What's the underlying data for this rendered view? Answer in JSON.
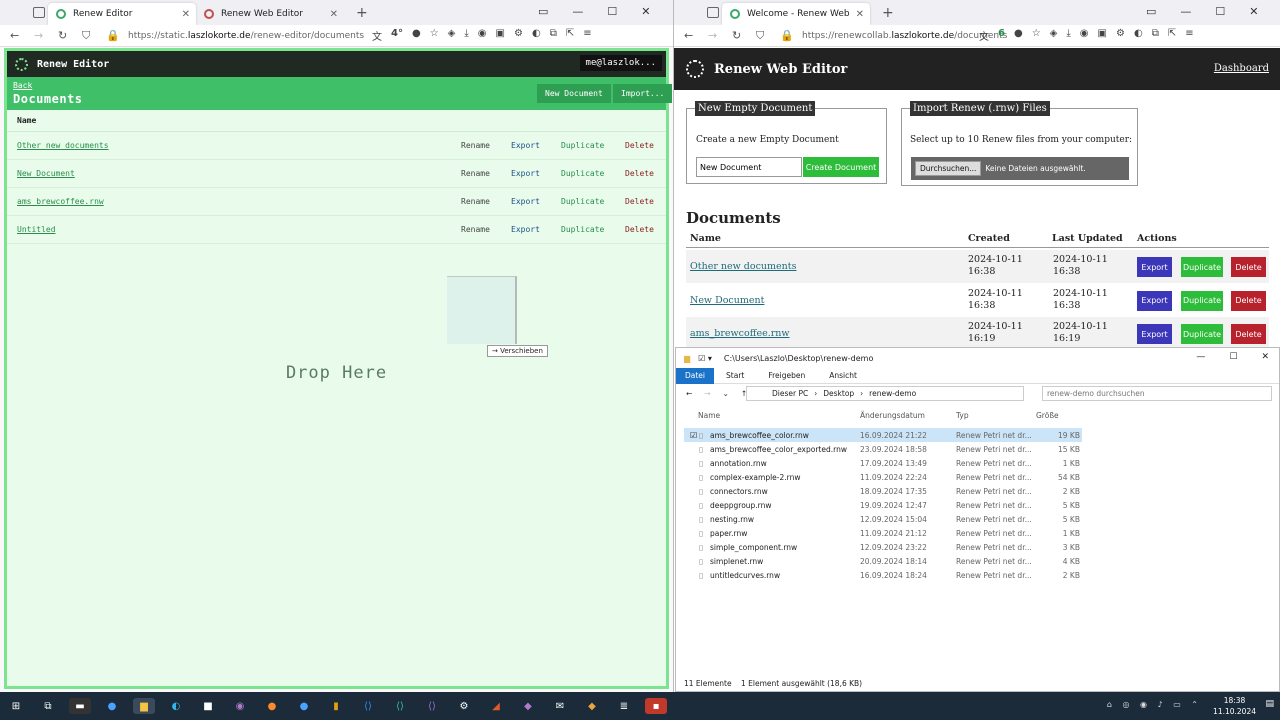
{
  "left_browser": {
    "tabs": [
      {
        "label": "Renew Editor",
        "active": true
      },
      {
        "label": "Renew Web Editor",
        "active": false
      }
    ],
    "url_prefix": "https://static.",
    "url_host": "laszlokorte.de",
    "url_path": "/renew-editor/documents",
    "badge": "4°"
  },
  "editor": {
    "app_title": "Renew Editor",
    "user": "me@laszlok...",
    "back": "Back",
    "title": "Documents",
    "new_document": "New Document",
    "import": "Import...",
    "col_name": "Name",
    "actions": {
      "rename": "Rename",
      "export": "Export",
      "duplicate": "Duplicate",
      "delete": "Delete"
    },
    "documents": [
      "Other new documents",
      "New Document",
      "ams_brewcoffee.rnw",
      "Untitled"
    ],
    "drop_here": "Drop Here",
    "drag_tooltip": "Verschieben"
  },
  "right_browser": {
    "tabs": [
      {
        "label": "Welcome - Renew Web",
        "active": true
      }
    ],
    "url_prefix": "https://renewcollab.",
    "url_host": "laszlokorte.de",
    "url_path": "/documents",
    "badge": "6"
  },
  "webeditor": {
    "app_title": "Renew Web Editor",
    "dashboard": "Dashboard",
    "new_empty": {
      "legend": "New Empty Document",
      "text": "Create a new Empty Document",
      "input_value": "New Document",
      "button": "Create Document"
    },
    "import_box": {
      "legend": "Import Renew (.rnw) Files",
      "text": "Select up to 10 Renew files from your computer:",
      "browse": "Durchsuchen...",
      "none": "Keine Dateien ausgewählt."
    },
    "title": "Documents",
    "headers": {
      "name": "Name",
      "created": "Created",
      "updated": "Last Updated",
      "actions": "Actions"
    },
    "rows": [
      {
        "name": "Other new documents",
        "created_date": "2024-10-11",
        "created_time": "16:38",
        "updated_date": "2024-10-11",
        "updated_time": "16:38"
      },
      {
        "name": "New Document",
        "created_date": "2024-10-11",
        "created_time": "16:38",
        "updated_date": "2024-10-11",
        "updated_time": "16:38"
      },
      {
        "name": "ams_brewcoffee.rnw",
        "created_date": "2024-10-11",
        "created_time": "16:19",
        "updated_date": "2024-10-11",
        "updated_time": "16:19"
      }
    ],
    "btn_export": "Export",
    "btn_duplicate": "Duplicate",
    "btn_delete": "Delete",
    "colors": {
      "export": "#3b37b8",
      "duplicate": "#2ebd3a",
      "delete": "#b8222d"
    }
  },
  "explorer": {
    "title_path": "C:\\Users\\Laszlo\\Desktop\\renew-demo",
    "ribbon": [
      "Datei",
      "Start",
      "Freigeben",
      "Ansicht"
    ],
    "crumbs": [
      "Dieser PC",
      "Desktop",
      "renew-demo"
    ],
    "search_placeholder": "renew-demo durchsuchen",
    "headers": {
      "name": "Name",
      "date": "Änderungsdatum",
      "type": "Typ",
      "size": "Größe"
    },
    "files": [
      {
        "name": "ams_brewcoffee_color.rnw",
        "date": "16.09.2024 21:22",
        "type": "Renew Petri net dr...",
        "size": "19 KB"
      },
      {
        "name": "ams_brewcoffee_color_exported.rnw",
        "date": "23.09.2024 18:58",
        "type": "Renew Petri net dr...",
        "size": "15 KB"
      },
      {
        "name": "annotation.rnw",
        "date": "17.09.2024 13:49",
        "type": "Renew Petri net dr...",
        "size": "1 KB"
      },
      {
        "name": "complex-example-2.rnw",
        "date": "11.09.2024 22:24",
        "type": "Renew Petri net dr...",
        "size": "54 KB"
      },
      {
        "name": "connectors.rnw",
        "date": "18.09.2024 17:35",
        "type": "Renew Petri net dr...",
        "size": "2 KB"
      },
      {
        "name": "deeppgroup.rnw",
        "date": "19.09.2024 12:47",
        "type": "Renew Petri net dr...",
        "size": "5 KB"
      },
      {
        "name": "nesting.rnw",
        "date": "12.09.2024 15:04",
        "type": "Renew Petri net dr...",
        "size": "5 KB"
      },
      {
        "name": "paper.rnw",
        "date": "11.09.2024 21:12",
        "type": "Renew Petri net dr...",
        "size": "1 KB"
      },
      {
        "name": "simple_component.rnw",
        "date": "12.09.2024 23:22",
        "type": "Renew Petri net dr...",
        "size": "3 KB"
      },
      {
        "name": "simplenet.rnw",
        "date": "20.09.2024 18:14",
        "type": "Renew Petri net dr...",
        "size": "4 KB"
      },
      {
        "name": "untitledcurves.rnw",
        "date": "16.09.2024 18:24",
        "type": "Renew Petri net dr...",
        "size": "2 KB"
      }
    ],
    "status_count": "11 Elemente",
    "status_selected": "1 Element ausgewählt (18,6 KB)"
  },
  "taskbar": {
    "time": "18:38",
    "date": "11.10.2024"
  }
}
